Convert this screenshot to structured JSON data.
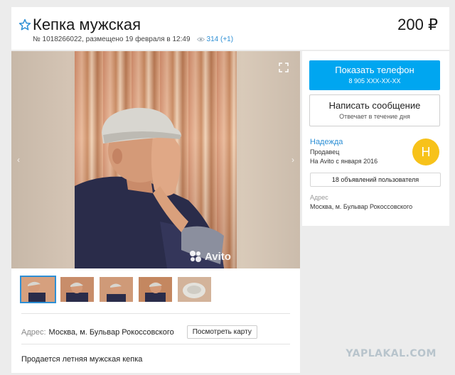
{
  "listing": {
    "title": "Кепка мужская",
    "price": "200 ₽",
    "number": "№ 1018266022, размещено 19 февраля в 12:49",
    "views": "314 (+1)",
    "address_label": "Адрес:",
    "address": "Москва, м. Бульвар Рокоссовского",
    "map_button": "Посмотреть карту",
    "description": "Продается летняя мужская кепка"
  },
  "gallery": {
    "watermark": "Avito",
    "thumbnails": 5,
    "active_thumbnail": 1
  },
  "contact": {
    "phone_label": "Показать телефон",
    "phone_masked": "8 905 XXX-XX-XX",
    "message_label": "Написать сообщение",
    "message_sub": "Отвечает в течение дня"
  },
  "seller": {
    "name": "Надежда",
    "role": "Продавец",
    "since": "На Avito с января 2016",
    "avatar_letter": "Н",
    "ads_button": "18 объявлений пользователя",
    "address_label": "Адрес",
    "address": "Москва, м. Бульвар Рокоссовского"
  },
  "site_watermark": "YAPLAKAL.COM",
  "colors": {
    "accent": "#00a6f0",
    "link": "#2d8fd5",
    "avatar": "#f7c21a"
  },
  "icons": [
    "star-icon",
    "eye-icon",
    "fullscreen-icon",
    "arrow-left-icon",
    "arrow-right-icon",
    "avito-logo-icon"
  ]
}
